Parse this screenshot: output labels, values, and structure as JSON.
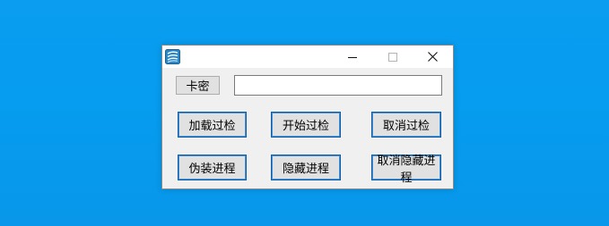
{
  "window": {
    "title": "",
    "icon": "app-icon"
  },
  "titlebar": {
    "minimize_icon": "minimize-icon",
    "maximize_icon": "maximize-icon",
    "close_icon": "close-icon"
  },
  "form": {
    "card_label": "卡密",
    "card_value": "",
    "card_placeholder": ""
  },
  "buttons": {
    "load_bypass": "加载过检",
    "start_bypass": "开始过检",
    "cancel_bypass": "取消过检",
    "disguise_process": "伪装进程",
    "hide_process": "隐藏进程",
    "cancel_hide_process": "取消隐藏进程"
  },
  "colors": {
    "desktop": "#069cef",
    "window_bg": "#f0f0f0",
    "titlebar_bg": "#ffffff",
    "button_border": "#0b5ea8"
  }
}
